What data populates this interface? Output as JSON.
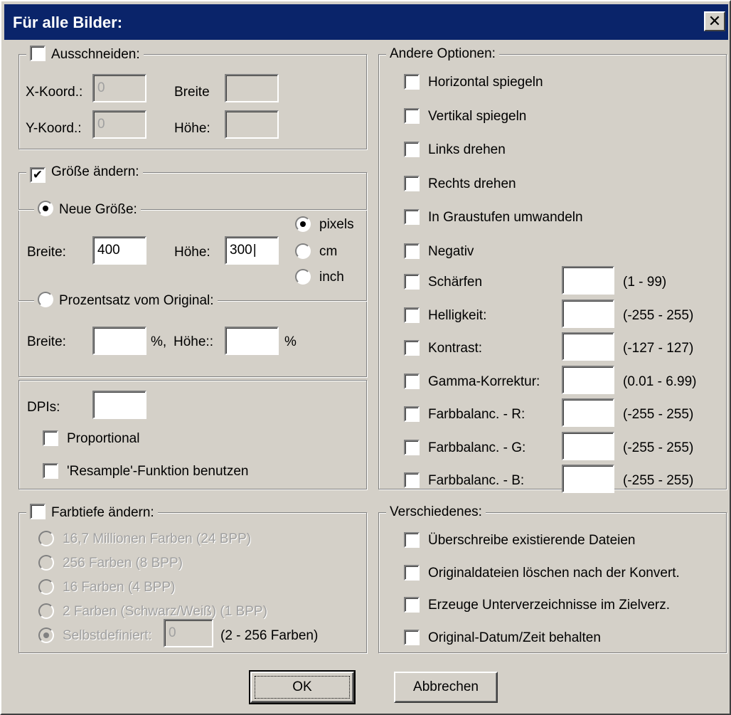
{
  "window": {
    "title": "Für alle Bilder:",
    "close_glyph": "✕"
  },
  "crop": {
    "checkbox_label": "Ausschneiden:",
    "checked": false,
    "x_label": "X-Koord.:",
    "x_value": "0",
    "y_label": "Y-Koord.:",
    "y_value": "0",
    "width_label": "Breite",
    "width_value": "",
    "height_label": "Höhe:",
    "height_value": ""
  },
  "resize": {
    "checkbox_label": "Größe ändern:",
    "checked": true,
    "new_size": {
      "radio_label": "Neue Größe:",
      "width_label": "Breite:",
      "width_value": "400",
      "height_label": "Höhe:",
      "height_value": "300",
      "units": [
        "pixels",
        "cm",
        "inch"
      ],
      "selected_unit": "pixels"
    },
    "percent": {
      "radio_label": "Prozentsatz vom Original:",
      "width_label": "Breite:",
      "width_value": "",
      "pct1": "%,",
      "height_label": "Höhe::",
      "height_value": "",
      "pct2": "%"
    },
    "selected_mode": "new_size"
  },
  "dpi": {
    "label": "DPIs:",
    "value": "",
    "proportional_label": "Proportional",
    "resample_label": "'Resample'-Funktion benutzen"
  },
  "color_depth": {
    "checkbox_label": "Farbtiefe ändern:",
    "options": [
      "16,7 Millionen Farben (24 BPP)",
      "256 Farben (8 BPP)",
      "16 Farben (4 BPP)",
      "2 Farben (Schwarz/Weiß) (1 BPP)"
    ],
    "custom_label": "Selbstdefiniert:",
    "custom_value": "0",
    "custom_range": "(2 - 256 Farben)"
  },
  "other_options": {
    "title": "Andere Optionen:",
    "items": [
      "Horizontal spiegeln",
      "Vertikal spiegeln",
      "Links drehen",
      "Rechts drehen",
      "In Graustufen umwandeln",
      "Negativ"
    ],
    "value_items": [
      {
        "label": "Schärfen",
        "range": "(1  -  99)"
      },
      {
        "label": "Helligkeit:",
        "range": "(-255  -  255)"
      },
      {
        "label": "Kontrast:",
        "range": "(-127  -  127)"
      },
      {
        "label": "Gamma-Korrektur:",
        "range": "(0.01  -  6.99)"
      },
      {
        "label": "Farbbalanc. - R:",
        "range": "(-255  -  255)"
      },
      {
        "label": "Farbbalanc. - G:",
        "range": "(-255  -  255)"
      },
      {
        "label": "Farbbalanc. - B:",
        "range": "(-255  -  255)"
      }
    ]
  },
  "misc": {
    "title": "Verschiedenes:",
    "items": [
      "Überschreibe existierende Dateien",
      "Originaldateien löschen nach der Konvert.",
      "Erzeuge Unterverzeichnisse im Zielverz.",
      "Original-Datum/Zeit behalten"
    ]
  },
  "buttons": {
    "ok": "OK",
    "cancel": "Abbrechen"
  },
  "colors": {
    "titlebar": "#0a246a",
    "face": "#d4d0c8"
  }
}
